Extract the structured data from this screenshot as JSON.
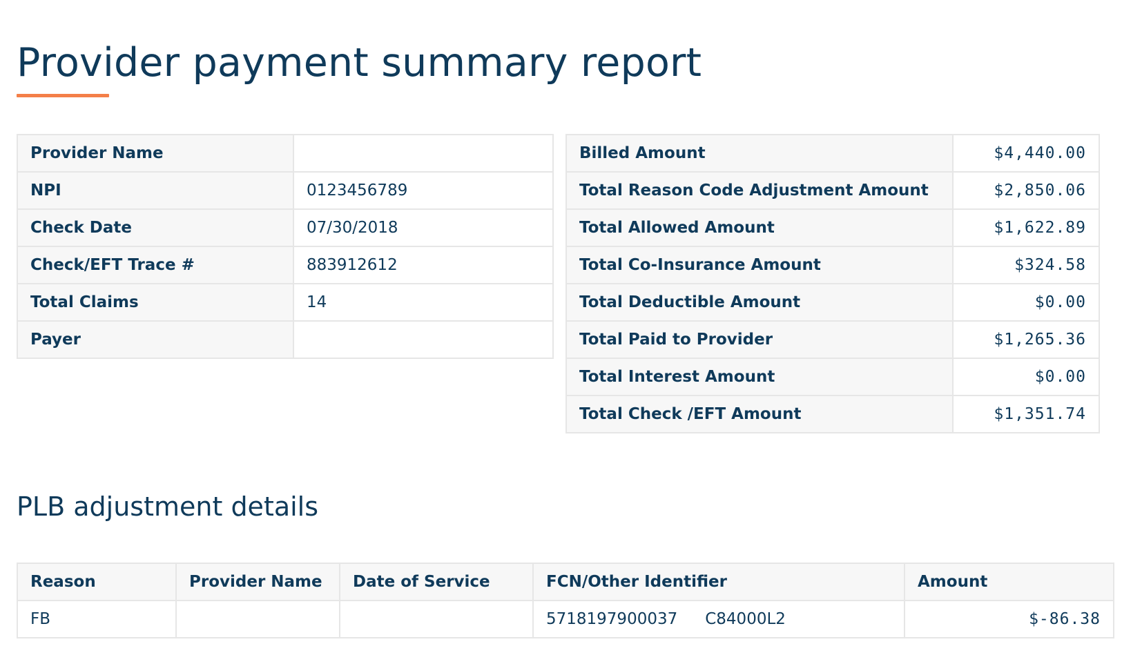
{
  "page": {
    "title": "Provider payment summary report",
    "plb_title": "PLB adjustment details"
  },
  "provider_info": [
    {
      "label": "Provider Name",
      "value": ""
    },
    {
      "label": "NPI",
      "value": "0123456789"
    },
    {
      "label": "Check Date",
      "value": "07/30/2018"
    },
    {
      "label": "Check/EFT Trace #",
      "value": "883912612"
    },
    {
      "label": "Total Claims",
      "value": "14"
    },
    {
      "label": "Payer",
      "value": ""
    }
  ],
  "amounts": [
    {
      "label": "Billed Amount",
      "value": "$4,440.00"
    },
    {
      "label": "Total Reason Code Adjustment Amount",
      "value": "$2,850.06"
    },
    {
      "label": "Total Allowed Amount",
      "value": "$1,622.89"
    },
    {
      "label": "Total Co-Insurance Amount",
      "value": "$324.58"
    },
    {
      "label": "Total Deductible Amount",
      "value": "$0.00"
    },
    {
      "label": "Total Paid to Provider",
      "value": "$1,265.36"
    },
    {
      "label": "Total Interest Amount",
      "value": "$0.00"
    },
    {
      "label": "Total Check /EFT Amount",
      "value": "$1,351.74"
    }
  ],
  "plb": {
    "columns": [
      "Reason",
      "Provider Name",
      "Date of Service",
      "FCN/Other Identifier",
      "Amount"
    ],
    "rows": [
      {
        "reason": "FB",
        "provider_name": "",
        "date_of_service": "",
        "fcn": "5718197900037",
        "other_identifier": "C84000L2",
        "amount": "$-86.38"
      }
    ]
  },
  "colors": {
    "text": "#0f3a5a",
    "accent": "#f47f48",
    "label_bg": "#f7f7f7",
    "border": "#e6e6e6"
  }
}
